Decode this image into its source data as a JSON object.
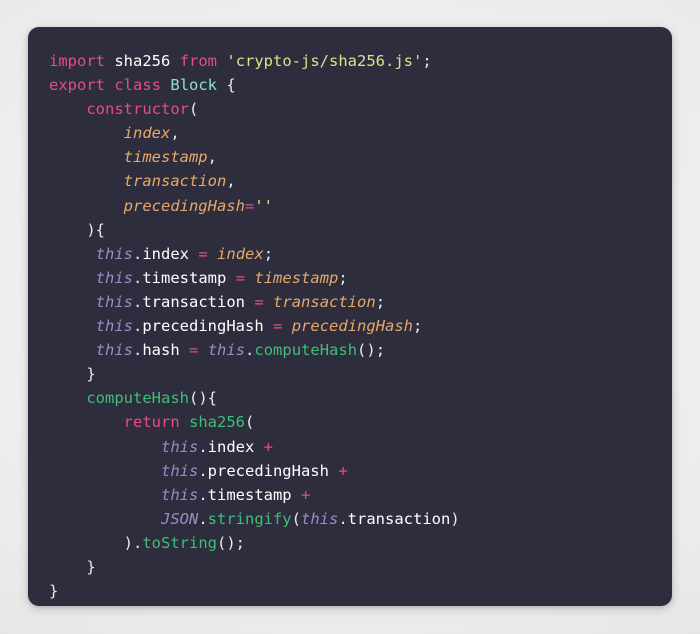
{
  "window": {
    "kind": "code-snippet-image",
    "language": "javascript",
    "background_color": "#f2f1f1",
    "card_color": "#2e2d3d",
    "card_radius_px": 11
  },
  "theme": {
    "name": "dark-dracula-like",
    "colors": {
      "background": "#2e2d3d",
      "foreground": "#e8e8ef",
      "keyword": "#e44c8c",
      "class_name": "#8de0d0",
      "string": "#dfe08a",
      "function": "#3fbe77",
      "this_keyword": "#9a8cc8",
      "parameter": "#e5a96a",
      "operator": "#e44c8c",
      "punctuation": "#e8e8ef"
    }
  },
  "code": {
    "line_count": 23,
    "plain_text": "import sha256 from 'crypto-js/sha256.js';\nexport class Block {\n    constructor(\n        index,\n        timestamp,\n        transaction,\n        precedingHash=''\n    ){\n     this.index = index;\n     this.timestamp = timestamp;\n     this.transaction = transaction;\n     this.precedingHash = precedingHash;\n     this.hash = this.computeHash();\n    }\n    computeHash(){\n        return sha256(\n            this.index +\n            this.precedingHash +\n            this.timestamp +\n            JSON.stringify(this.transaction)\n        ).toString();\n    }\n}",
    "lines": [
      {
        "n": 1,
        "text": "import sha256 from 'crypto-js/sha256.js';"
      },
      {
        "n": 2,
        "text": "export class Block {"
      },
      {
        "n": 3,
        "text": "    constructor("
      },
      {
        "n": 4,
        "text": "        index,"
      },
      {
        "n": 5,
        "text": "        timestamp,"
      },
      {
        "n": 6,
        "text": "        transaction,"
      },
      {
        "n": 7,
        "text": "        precedingHash=''"
      },
      {
        "n": 8,
        "text": "    ){"
      },
      {
        "n": 9,
        "text": "     this.index = index;"
      },
      {
        "n": 10,
        "text": "     this.timestamp = timestamp;"
      },
      {
        "n": 11,
        "text": "     this.transaction = transaction;"
      },
      {
        "n": 12,
        "text": "     this.precedingHash = precedingHash;"
      },
      {
        "n": 13,
        "text": "     this.hash = this.computeHash();"
      },
      {
        "n": 14,
        "text": "    }"
      },
      {
        "n": 15,
        "text": "    computeHash(){"
      },
      {
        "n": 16,
        "text": "        return sha256("
      },
      {
        "n": 17,
        "text": "            this.index +"
      },
      {
        "n": 18,
        "text": "            this.precedingHash +"
      },
      {
        "n": 19,
        "text": "            this.timestamp +"
      },
      {
        "n": 20,
        "text": "            JSON.stringify(this.transaction)"
      },
      {
        "n": 21,
        "text": "        ).toString();"
      },
      {
        "n": 22,
        "text": "    }"
      },
      {
        "n": 23,
        "text": "}"
      }
    ],
    "tokens": {
      "keywords": [
        "import",
        "from",
        "export",
        "class",
        "return",
        "constructor"
      ],
      "class_names": [
        "Block"
      ],
      "strings": [
        "'crypto-js/sha256.js'",
        "''"
      ],
      "functions": [
        "computeHash",
        "sha256",
        "stringify",
        "toString"
      ],
      "identifiers": [
        "sha256",
        "JSON"
      ],
      "this_refs": [
        "this"
      ],
      "parameters": [
        "index",
        "timestamp",
        "transaction",
        "precedingHash"
      ],
      "properties": [
        "index",
        "timestamp",
        "transaction",
        "precedingHash",
        "hash"
      ]
    }
  }
}
